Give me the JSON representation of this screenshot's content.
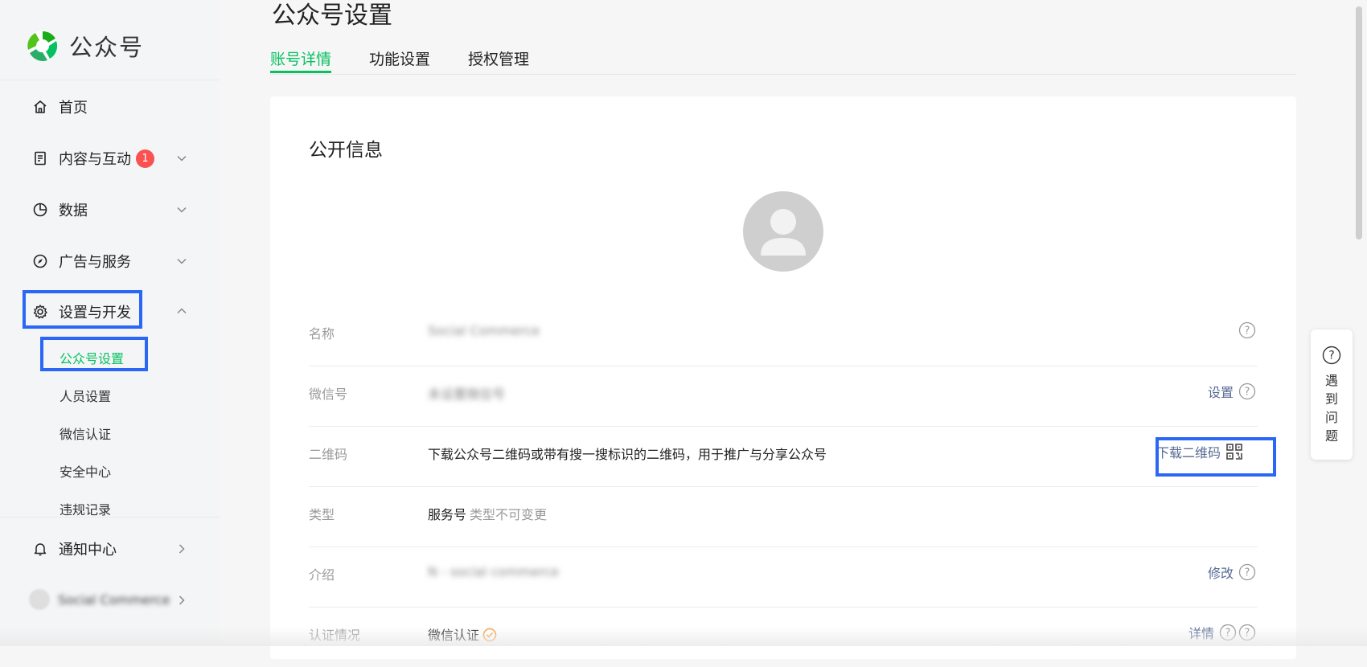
{
  "app": {
    "name": "公众号"
  },
  "sidebar": {
    "items": [
      {
        "label": "首页",
        "icon": "home-icon"
      },
      {
        "label": "内容与互动",
        "icon": "document-icon",
        "badge": "1"
      },
      {
        "label": "数据",
        "icon": "pie-chart-icon"
      },
      {
        "label": "广告与服务",
        "icon": "compass-icon"
      },
      {
        "label": "设置与开发",
        "icon": "gear-icon",
        "expanded": true
      }
    ],
    "sub_items": [
      "公众号设置",
      "人员设置",
      "微信认证",
      "安全中心",
      "违规记录"
    ],
    "notification": {
      "label": "通知中心",
      "icon": "bell-icon"
    },
    "account": {
      "name": "Social Commerce"
    }
  },
  "page": {
    "title": "公众号设置",
    "tabs": [
      "账号详情",
      "功能设置",
      "授权管理"
    ]
  },
  "card": {
    "title": "公开信息",
    "rows": [
      {
        "label": "名称",
        "value": "Social Commerce"
      },
      {
        "label": "微信号",
        "value": "未设置微信号",
        "action": "设置"
      },
      {
        "label": "二维码",
        "value": "下载公众号二维码或带有搜一搜标识的二维码，用于推广与分享公众号",
        "action": "下载二维码"
      },
      {
        "label": "类型",
        "value": "服务号",
        "note": "类型不可变更"
      },
      {
        "label": "介绍",
        "value": "N - social commerce",
        "action": "修改"
      },
      {
        "label": "认证情况",
        "value": "微信认证",
        "action": "详情"
      }
    ]
  },
  "help_widget": {
    "text": "遇到问题"
  },
  "colors": {
    "accent": "#07c160",
    "link": "#576b95",
    "badge": "#fa5151",
    "highlight": "#2b67f6"
  }
}
